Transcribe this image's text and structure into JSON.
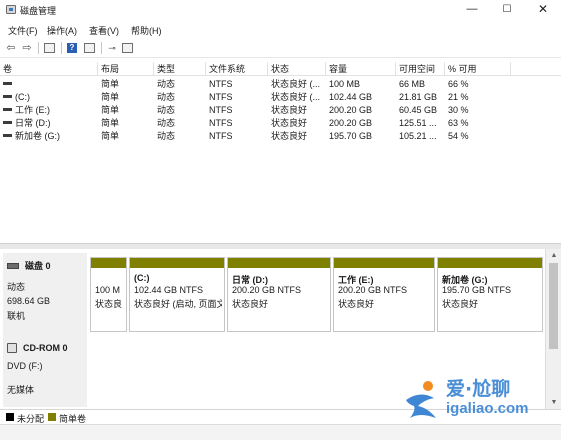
{
  "window": {
    "title": "磁盘管理",
    "minimize": "—",
    "maximize": "☐",
    "close": "✕"
  },
  "menu": [
    "文件(F)",
    "操作(A)",
    "查看(V)",
    "帮助(H)"
  ],
  "toolbar": {
    "back": "⇦",
    "forward": "⇨",
    "help": "?"
  },
  "table": {
    "headers": [
      "卷",
      "布局",
      "类型",
      "文件系统",
      "状态",
      "容量",
      "可用空间",
      "% 可用"
    ],
    "rows": [
      {
        "volume": "",
        "layout": "简单",
        "type": "动态",
        "fs": "NTFS",
        "status": "状态良好 (...",
        "capacity": "100 MB",
        "free": "66 MB",
        "pct": "66 %"
      },
      {
        "volume": "(C:)",
        "layout": "简单",
        "type": "动态",
        "fs": "NTFS",
        "status": "状态良好 (...",
        "capacity": "102.44 GB",
        "free": "21.81 GB",
        "pct": "21 %"
      },
      {
        "volume": "工作 (E:)",
        "layout": "简单",
        "type": "动态",
        "fs": "NTFS",
        "status": "状态良好",
        "capacity": "200.20 GB",
        "free": "60.45 GB",
        "pct": "30 %"
      },
      {
        "volume": "日常 (D:)",
        "layout": "简单",
        "type": "动态",
        "fs": "NTFS",
        "status": "状态良好",
        "capacity": "200.20 GB",
        "free": "125.51 ...",
        "pct": "63 %"
      },
      {
        "volume": "新加卷 (G:)",
        "layout": "简单",
        "type": "动态",
        "fs": "NTFS",
        "status": "状态良好",
        "capacity": "195.70 GB",
        "free": "105.21 ...",
        "pct": "54 %"
      }
    ]
  },
  "disk0": {
    "name": "磁盘 0",
    "type": "动态",
    "size": "698.64 GB",
    "state": "联机",
    "partitions": [
      {
        "label": "",
        "size": "100 M",
        "status": "状态良"
      },
      {
        "label": "(C:)",
        "size": "102.44 GB NTFS",
        "status": "状态良好 (启动, 页面文"
      },
      {
        "label": "日常  (D:)",
        "size": "200.20 GB NTFS",
        "status": "状态良好"
      },
      {
        "label": "工作  (E:)",
        "size": "200.20 GB NTFS",
        "status": "状态良好"
      },
      {
        "label": "新加卷  (G:)",
        "size": "195.70 GB NTFS",
        "status": "状态良好"
      }
    ]
  },
  "cdrom": {
    "name": "CD-ROM 0",
    "drive": "DVD (F:)",
    "media": "无媒体"
  },
  "legend": [
    {
      "label": "未分配",
      "color": "#000000"
    },
    {
      "label": "简单卷",
      "color": "#808000"
    }
  ],
  "watermark": {
    "title": "爱·尬聊",
    "url": "igaliao.com"
  },
  "colors": {
    "simple_volume": "#808000",
    "unallocated": "#000000",
    "watermark": "#4a8fd6"
  }
}
